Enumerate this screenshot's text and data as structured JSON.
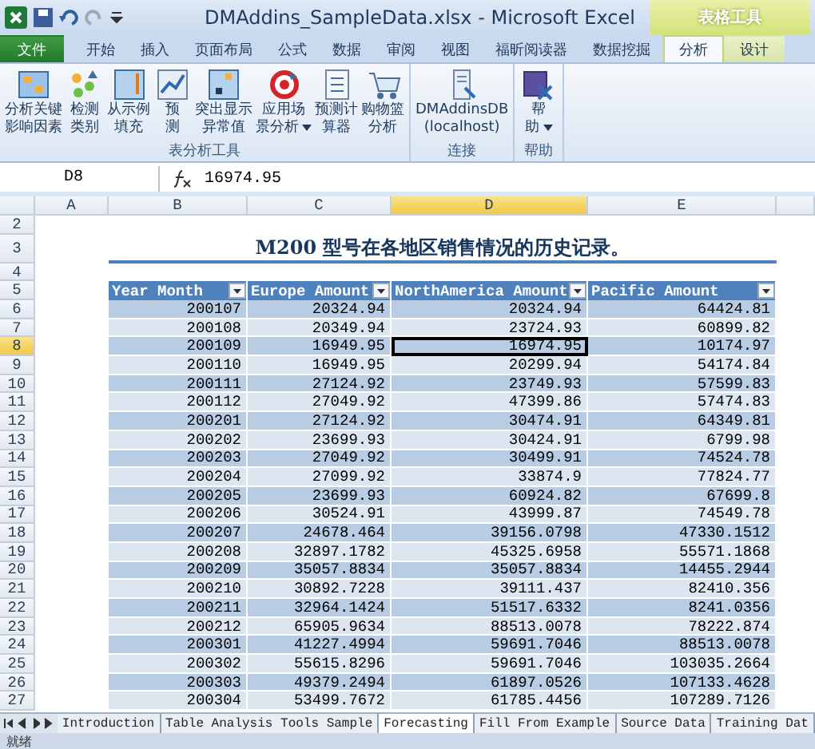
{
  "window": {
    "title": "DMAddins_SampleData.xlsx - Microsoft Excel"
  },
  "contextual_tab_group": {
    "label": "表格工具"
  },
  "tabs": [
    {
      "label": "文件",
      "kind": "file",
      "selected": false
    },
    {
      "label": "开始",
      "kind": "normal",
      "selected": false
    },
    {
      "label": "插入",
      "kind": "normal",
      "selected": false
    },
    {
      "label": "页面布局",
      "kind": "normal",
      "selected": false
    },
    {
      "label": "公式",
      "kind": "normal",
      "selected": false
    },
    {
      "label": "数据",
      "kind": "normal",
      "selected": false
    },
    {
      "label": "审阅",
      "kind": "normal",
      "selected": false
    },
    {
      "label": "视图",
      "kind": "normal",
      "selected": false
    },
    {
      "label": "福昕阅读器",
      "kind": "normal",
      "selected": false
    },
    {
      "label": "数据挖掘",
      "kind": "normal",
      "selected": false
    },
    {
      "label": "分析",
      "kind": "contextual",
      "selected": true
    },
    {
      "label": "设计",
      "kind": "contextual",
      "selected": false
    }
  ],
  "ribbon_groups": [
    {
      "label": "表分析工具",
      "buttons": [
        {
          "lines": [
            "分析关键",
            "影响因素"
          ],
          "dropdown": false
        },
        {
          "lines": [
            "检测",
            "类别"
          ],
          "dropdown": false
        },
        {
          "lines": [
            "从示例",
            "填充"
          ],
          "dropdown": false
        },
        {
          "lines": [
            "预",
            "测"
          ],
          "dropdown": false
        },
        {
          "lines": [
            "突出显示",
            "异常值"
          ],
          "dropdown": false
        },
        {
          "lines": [
            "应用场",
            "景分析"
          ],
          "dropdown": true
        },
        {
          "lines": [
            "预测计",
            "算器"
          ],
          "dropdown": false
        },
        {
          "lines": [
            "购物篮",
            "分析"
          ],
          "dropdown": false
        }
      ]
    },
    {
      "label": "连接",
      "buttons": [
        {
          "lines": [
            "DMAddinsDB",
            "(localhost)"
          ],
          "dropdown": false
        }
      ]
    },
    {
      "label": "帮助",
      "buttons": [
        {
          "lines": [
            "帮",
            "助"
          ],
          "dropdown": true
        }
      ]
    }
  ],
  "formula_bar": {
    "name_box": "D8",
    "value": "16974.95"
  },
  "columns": [
    {
      "label": "A",
      "selected": false
    },
    {
      "label": "B",
      "selected": false
    },
    {
      "label": "C",
      "selected": false
    },
    {
      "label": "D",
      "selected": true
    },
    {
      "label": "E",
      "selected": false
    }
  ],
  "sheet_title": {
    "row": "3",
    "text": "M200 型号在各地区销售情况的历史记录。"
  },
  "blank_rows": [
    "2",
    "4"
  ],
  "table": {
    "row": "5",
    "columns": [
      "Year Month",
      "Europe Amount",
      "NorthAmerica Amount",
      "Pacific Amount"
    ],
    "rows": [
      {
        "row": "6",
        "cells": [
          "200107",
          "20324.94",
          "20324.94",
          "64424.81"
        ],
        "selected": false
      },
      {
        "row": "7",
        "cells": [
          "200108",
          "20349.94",
          "23724.93",
          "60899.82"
        ],
        "selected": false
      },
      {
        "row": "8",
        "cells": [
          "200109",
          "16949.95",
          "16974.95",
          "10174.97"
        ],
        "selected": true
      },
      {
        "row": "9",
        "cells": [
          "200110",
          "16949.95",
          "20299.94",
          "54174.84"
        ],
        "selected": false
      },
      {
        "row": "10",
        "cells": [
          "200111",
          "27124.92",
          "23749.93",
          "57599.83"
        ],
        "selected": false
      },
      {
        "row": "11",
        "cells": [
          "200112",
          "27049.92",
          "47399.86",
          "57474.83"
        ],
        "selected": false
      },
      {
        "row": "12",
        "cells": [
          "200201",
          "27124.92",
          "30474.91",
          "64349.81"
        ],
        "selected": false
      },
      {
        "row": "13",
        "cells": [
          "200202",
          "23699.93",
          "30424.91",
          "6799.98"
        ],
        "selected": false
      },
      {
        "row": "14",
        "cells": [
          "200203",
          "27049.92",
          "30499.91",
          "74524.78"
        ],
        "selected": false
      },
      {
        "row": "15",
        "cells": [
          "200204",
          "27099.92",
          "33874.9",
          "77824.77"
        ],
        "selected": false
      },
      {
        "row": "16",
        "cells": [
          "200205",
          "23699.93",
          "60924.82",
          "67699.8"
        ],
        "selected": false
      },
      {
        "row": "17",
        "cells": [
          "200206",
          "30524.91",
          "43999.87",
          "74549.78"
        ],
        "selected": false
      },
      {
        "row": "18",
        "cells": [
          "200207",
          "24678.464",
          "39156.0798",
          "47330.1512"
        ],
        "selected": false
      },
      {
        "row": "19",
        "cells": [
          "200208",
          "32897.1782",
          "45325.6958",
          "55571.1868"
        ],
        "selected": false
      },
      {
        "row": "20",
        "cells": [
          "200209",
          "35057.8834",
          "35057.8834",
          "14455.2944"
        ],
        "selected": false
      },
      {
        "row": "21",
        "cells": [
          "200210",
          "30892.7228",
          "39111.437",
          "82410.356"
        ],
        "selected": false
      },
      {
        "row": "22",
        "cells": [
          "200211",
          "32964.1424",
          "51517.6332",
          "8241.0356"
        ],
        "selected": false
      },
      {
        "row": "23",
        "cells": [
          "200212",
          "65905.9634",
          "88513.0078",
          "78222.874"
        ],
        "selected": false
      },
      {
        "row": "24",
        "cells": [
          "200301",
          "41227.4994",
          "59691.7046",
          "88513.0078"
        ],
        "selected": false
      },
      {
        "row": "25",
        "cells": [
          "200302",
          "55615.8296",
          "59691.7046",
          "103035.2664"
        ],
        "selected": false
      },
      {
        "row": "26",
        "cells": [
          "200303",
          "49379.2494",
          "61897.0526",
          "107133.4628"
        ],
        "selected": false
      },
      {
        "row": "27",
        "cells": [
          "200304",
          "53499.7672",
          "61785.4456",
          "107289.7126"
        ],
        "selected": false
      }
    ]
  },
  "sheet_tabs": [
    {
      "label": "Introduction",
      "selected": false
    },
    {
      "label": "Table Analysis Tools Sample",
      "selected": false
    },
    {
      "label": "Forecasting",
      "selected": true
    },
    {
      "label": "Fill From Example",
      "selected": false
    },
    {
      "label": "Source Data",
      "selected": false
    },
    {
      "label": "Training Dat",
      "selected": false
    }
  ],
  "status_bar": {
    "text": "就绪"
  }
}
